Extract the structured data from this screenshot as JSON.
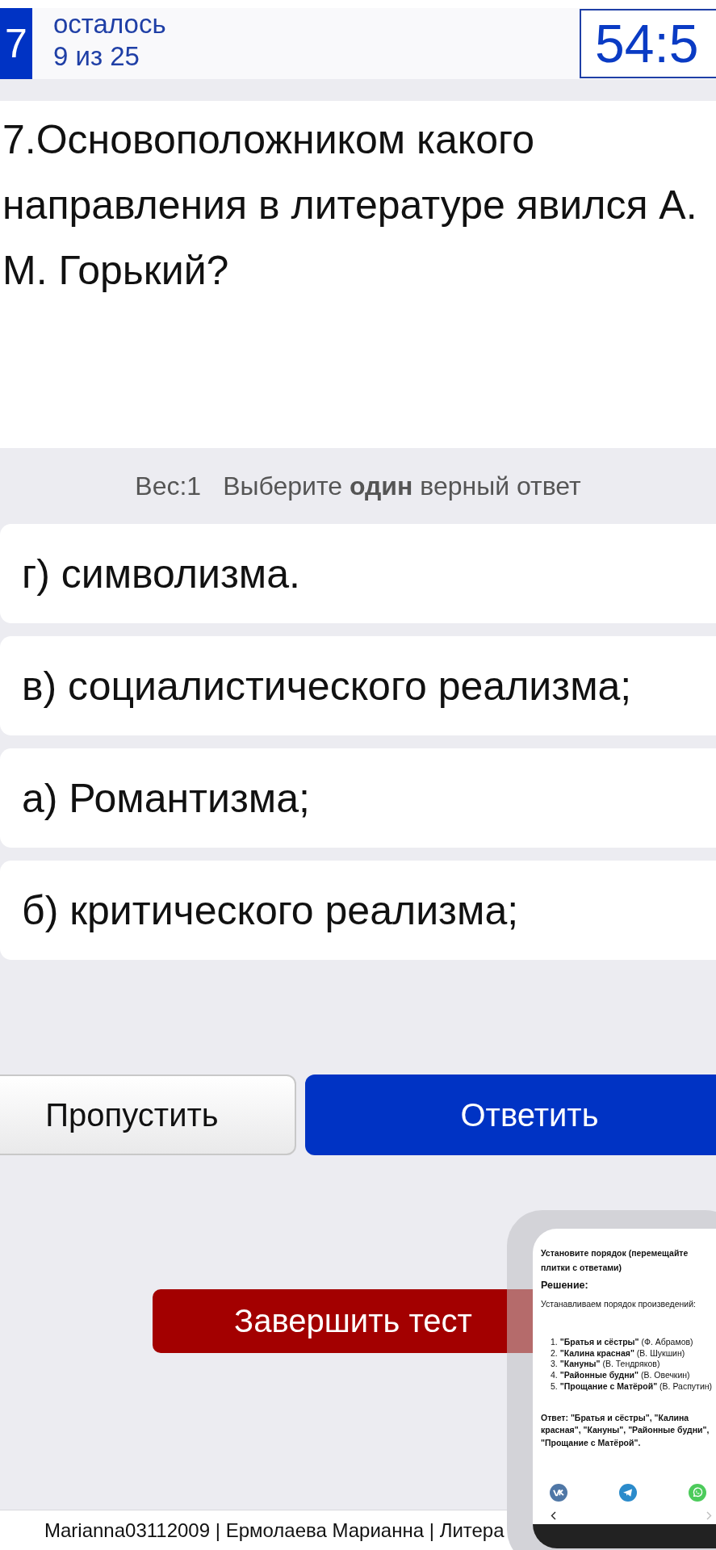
{
  "header": {
    "question_number": "7",
    "remaining_label": "осталось",
    "remaining_count": "9 из 25",
    "timer": "54:5"
  },
  "question": {
    "text": "7.Основоположником какого направления в литературе явился А. М. Горький?"
  },
  "instructions": {
    "weight": "Вес:1",
    "hint": "Выберите **один** верный ответ"
  },
  "options": [
    {
      "label": "г) символизма.",
      "selected": false
    },
    {
      "label": "в) социалистического реализма;",
      "selected": false
    },
    {
      "label": "а) Романтизма;",
      "selected": false
    },
    {
      "label": "б) критического реализма;",
      "selected": false
    }
  ],
  "actions": [
    {
      "kind": "secondary",
      "label": "Пропустить"
    },
    {
      "kind": "primary",
      "label": "Ответить"
    }
  ],
  "finish_button": {
    "label": "Завершить тест"
  },
  "footer": {
    "text": "Marianna03112009 | Ермолаева Марианна | Литера"
  },
  "phone_screenshot": {
    "task": "Установите порядок (перемещайте плитки с ответами)",
    "heading": "Решение:",
    "intro": "Устанавливаем порядок произведений:",
    "steps": [
      "1. **\"Братья и сёстры\"** (Ф. Абрамов)",
      "2. **\"Калина красная\"** (В. Шукшин)",
      "3. **\"Кануны\"** (В. Тендряков)",
      "4. **\"Районные будни\"** (В. Овечкин)",
      "5. **\"Прощание с Матёрой\"** (В. Распутин)"
    ],
    "answer": "Ответ: \"Братья и сёстры\", \"Калина красная\", \"Кануны\", \"Районные будни\", \"Прощание с Матёрой\".",
    "back_disabled": false,
    "forward_disabled": true
  }
}
